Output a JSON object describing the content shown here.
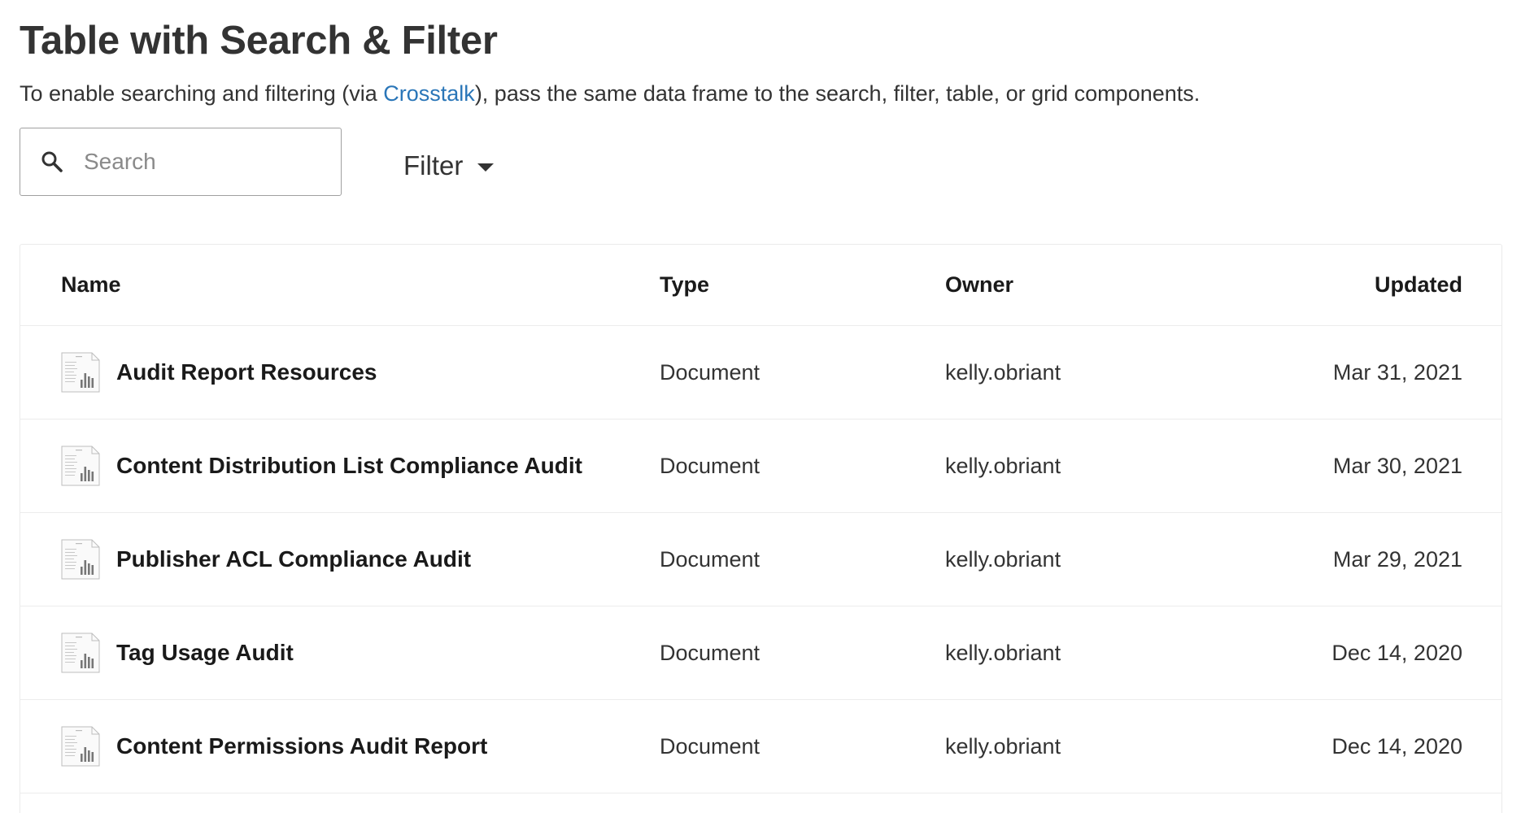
{
  "header": {
    "title": "Table with Search & Filter",
    "subtitle_before": "To enable searching and filtering (via ",
    "subtitle_link": "Crosstalk",
    "subtitle_after": "), pass the same data frame to the search, filter, table, or grid components."
  },
  "search": {
    "placeholder": "Search",
    "value": "",
    "icon": "search-icon"
  },
  "filter": {
    "label": "Filter",
    "icon": "chevron-down-icon"
  },
  "table": {
    "columns": {
      "name": "Name",
      "type": "Type",
      "owner": "Owner",
      "updated": "Updated"
    },
    "rows": [
      {
        "name": "Audit Report Resources",
        "type": "Document",
        "owner": "kelly.obriant",
        "updated": "Mar 31, 2021",
        "icon": "document-thumbnail-icon"
      },
      {
        "name": "Content Distribution List Compliance Audit",
        "type": "Document",
        "owner": "kelly.obriant",
        "updated": "Mar 30, 2021",
        "icon": "document-thumbnail-icon"
      },
      {
        "name": "Publisher ACL Compliance Audit",
        "type": "Document",
        "owner": "kelly.obriant",
        "updated": "Mar 29, 2021",
        "icon": "document-thumbnail-icon"
      },
      {
        "name": "Tag Usage Audit",
        "type": "Document",
        "owner": "kelly.obriant",
        "updated": "Dec 14, 2020",
        "icon": "document-thumbnail-icon"
      },
      {
        "name": "Content Permissions Audit Report",
        "type": "Document",
        "owner": "kelly.obriant",
        "updated": "Dec 14, 2020",
        "icon": "document-thumbnail-icon"
      }
    ]
  },
  "colors": {
    "link": "#2a76b8",
    "text": "#333333",
    "border": "#ececec"
  }
}
